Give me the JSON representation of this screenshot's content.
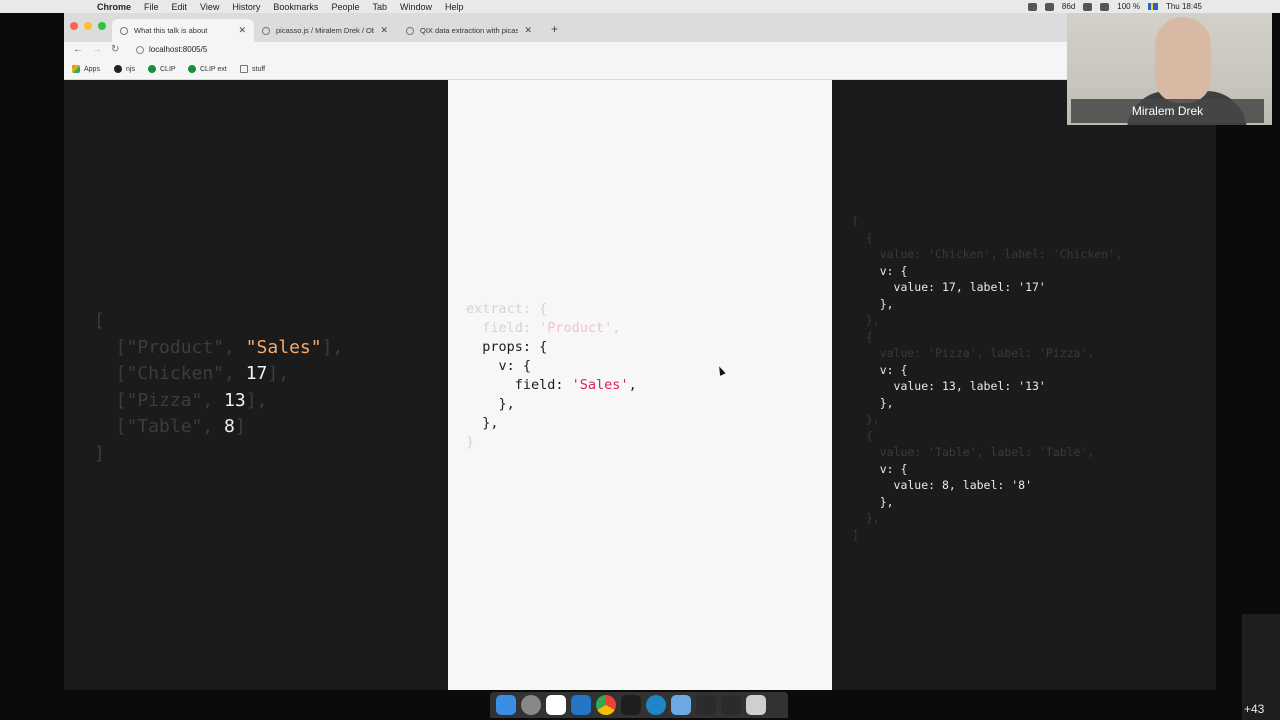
{
  "menubar": {
    "app": "Chrome",
    "items": [
      "File",
      "Edit",
      "View",
      "History",
      "Bookmarks",
      "People",
      "Tab",
      "Window",
      "Help"
    ],
    "status": {
      "battery": "100 %",
      "clock": "Thu 18:45",
      "misc": "86d"
    }
  },
  "browser": {
    "tabs": [
      {
        "label": "What this talk is about",
        "active": true
      },
      {
        "label": "picasso.js / Miralem Drek / Ob",
        "active": false
      },
      {
        "label": "QIX data extraction with picas",
        "active": false
      }
    ],
    "url": "localhost:8005/5",
    "bookmarks": [
      "Apps",
      "njs",
      "CLIP",
      "CLIP ext",
      "stuff"
    ]
  },
  "slides": {
    "left_lines": [
      {
        "text": "[",
        "tone": "dim"
      },
      {
        "parts": [
          {
            "t": "  [\"Product\", ",
            "tone": "dim"
          },
          {
            "t": "\"Sales\"",
            "tone": "orange"
          },
          {
            "t": "],",
            "tone": "dim"
          }
        ]
      },
      {
        "parts": [
          {
            "t": "  [\"Chicken\", ",
            "tone": "dim"
          },
          {
            "t": "17",
            "tone": "bright"
          },
          {
            "t": "],",
            "tone": "dim"
          }
        ]
      },
      {
        "parts": [
          {
            "t": "  [\"Pizza\", ",
            "tone": "dim"
          },
          {
            "t": "13",
            "tone": "bright"
          },
          {
            "t": "],",
            "tone": "dim"
          }
        ]
      },
      {
        "parts": [
          {
            "t": "  [\"Table\", ",
            "tone": "dim"
          },
          {
            "t": "8",
            "tone": "bright"
          },
          {
            "t": "]",
            "tone": "dim"
          }
        ]
      },
      {
        "text": "]",
        "tone": "dim"
      }
    ],
    "mid_lines": [
      {
        "parts": [
          {
            "t": "extract: {",
            "tone": "mid-dim"
          }
        ]
      },
      {
        "parts": [
          {
            "t": "  field: ",
            "tone": "mid-dim"
          },
          {
            "t": "'Product'",
            "tone": "mid-dim-pink"
          },
          {
            "t": ",",
            "tone": "mid-dim"
          }
        ]
      },
      {
        "parts": [
          {
            "t": "  props: {",
            "tone": "mid-txt"
          }
        ]
      },
      {
        "parts": [
          {
            "t": "    v: {",
            "tone": "mid-txt"
          }
        ]
      },
      {
        "parts": [
          {
            "t": "      field: ",
            "tone": "mid-txt"
          },
          {
            "t": "'Sales'",
            "tone": "mid-pink"
          },
          {
            "t": ",",
            "tone": "mid-txt"
          }
        ]
      },
      {
        "parts": [
          {
            "t": "    },",
            "tone": "mid-txt"
          }
        ]
      },
      {
        "parts": [
          {
            "t": "  },",
            "tone": "mid-txt"
          }
        ]
      },
      {
        "parts": [
          {
            "t": "}",
            "tone": "mid-dim"
          }
        ]
      }
    ],
    "right_lines": [
      {
        "t": "[",
        "tone": "r-dim"
      },
      {
        "t": "  {",
        "tone": "r-dim"
      },
      {
        "t": "    value: 'Chicken', label: 'Chicken',",
        "tone": "r-dim"
      },
      {
        "t": "    v: {",
        "tone": "r-txt"
      },
      {
        "t": "      value: 17, label: '17'",
        "tone": "r-txt"
      },
      {
        "t": "    },",
        "tone": "r-txt"
      },
      {
        "t": "  },",
        "tone": "r-dim"
      },
      {
        "t": "  {",
        "tone": "r-dim"
      },
      {
        "t": "    value: 'Pizza', label: 'Pizza',",
        "tone": "r-dim"
      },
      {
        "t": "    v: {",
        "tone": "r-txt"
      },
      {
        "t": "      value: 13, label: '13'",
        "tone": "r-txt"
      },
      {
        "t": "    },",
        "tone": "r-txt"
      },
      {
        "t": "  },",
        "tone": "r-dim"
      },
      {
        "t": "  {",
        "tone": "r-dim"
      },
      {
        "t": "    value: 'Table', label: 'Table',",
        "tone": "r-dim"
      },
      {
        "t": "    v: {",
        "tone": "r-txt"
      },
      {
        "t": "      value: 8, label: '8'",
        "tone": "r-txt"
      },
      {
        "t": "    },",
        "tone": "r-txt"
      },
      {
        "t": "  },",
        "tone": "r-dim"
      },
      {
        "t": "]",
        "tone": "r-dim"
      }
    ]
  },
  "video": {
    "speaker": "Miralem Drek"
  },
  "participants": {
    "more": "+43"
  },
  "dock": {
    "icons": [
      "finder-icon",
      "launchpad-icon",
      "slack-icon",
      "vscode-icon",
      "chrome-icon",
      "terminal-icon",
      "qlik-icon",
      "folder-icon",
      "screen-icon",
      "screen2-icon",
      "trash-icon"
    ]
  },
  "colors": {
    "accent_pink": "#d6245b",
    "accent_orange": "#f6a96c"
  }
}
